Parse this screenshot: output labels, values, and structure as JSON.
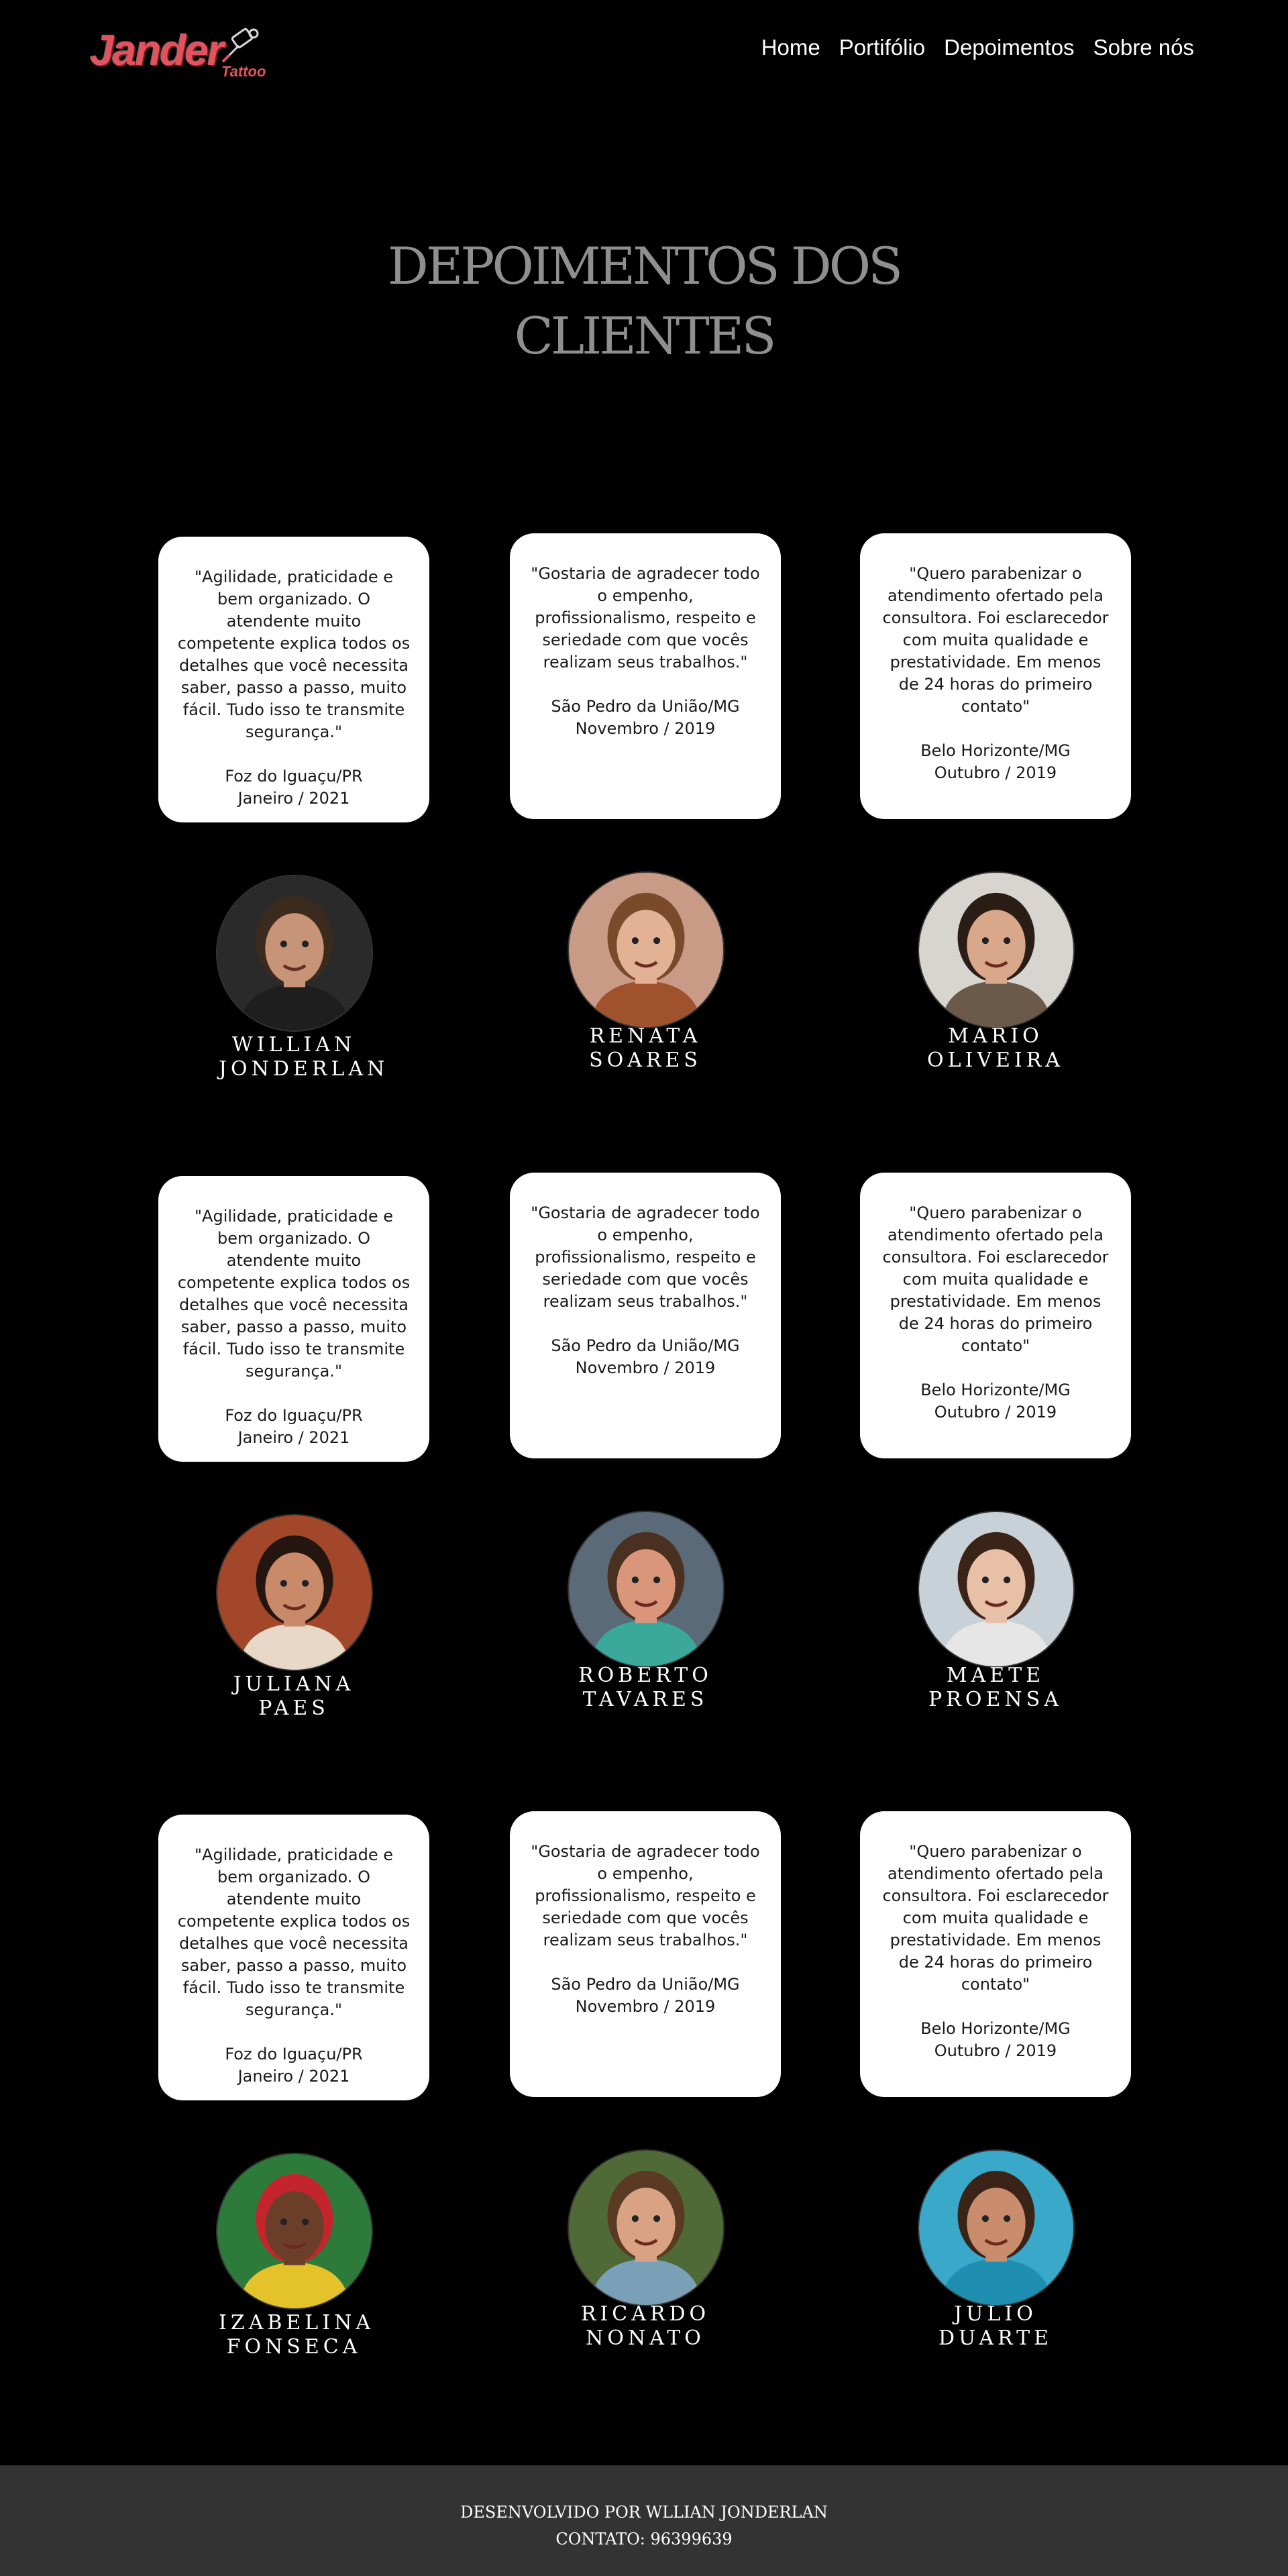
{
  "header": {
    "logo_text": "Jander",
    "logo_sub": "Tattoo",
    "nav": [
      "Home",
      "Portifólio",
      "Depoimentos",
      "Sobre nós"
    ]
  },
  "page_title": "DEPOIMENTOS DOS CLIENTES",
  "testimonials": [
    {
      "quote": "\"Agilidade, praticidade e bem organizado. O atendente muito competente explica todos os detalhes que você necessita saber, passo a passo, muito fácil. Tudo isso te transmite segurança.\"",
      "city": "Foz do Iguaçu/PR",
      "date": "Janeiro / 2021",
      "name": "WILLIAN JONDERLAN",
      "skin": "#c89478",
      "hair": "#3b2a1e",
      "bg": "#2a2a2a",
      "shirt": "#1e1e1e"
    },
    {
      "quote": "\"Gostaria de agradecer todo o empenho, profissionalismo, respeito e seriedade com que vocês realizam seus trabalhos.\"",
      "city": "São Pedro da União/MG",
      "date": "Novembro / 2019",
      "name": "RENATA SOARES",
      "skin": "#e3b194",
      "hair": "#7b4a2a",
      "bg": "#c99b87",
      "shirt": "#a0522d"
    },
    {
      "quote": "\"Quero parabenizar o atendimento ofertado pela consultora. Foi esclarecedor com muita qualidade e prestatividade. Em menos de 24 horas do primeiro contato\"",
      "city": "Belo Horizonte/MG",
      "date": "Outubro / 2019",
      "name": "MARIO OLIVEIRA",
      "skin": "#d9a88a",
      "hair": "#2a1d16",
      "bg": "#d8d4cf",
      "shirt": "#6b5a4a"
    },
    {
      "quote": "\"Agilidade, praticidade e bem organizado. O atendente muito competente explica todos os detalhes que você necessita saber, passo a passo, muito fácil. Tudo isso te transmite segurança.\"",
      "city": "Foz do Iguaçu/PR",
      "date": "Janeiro / 2021",
      "name": "JULIANA PAES",
      "skin": "#c98a6a",
      "hair": "#241510",
      "bg": "#a3472b",
      "shirt": "#e8d8c8"
    },
    {
      "quote": "\"Gostaria de agradecer todo o empenho, profissionalismo, respeito e seriedade com que vocês realizam seus trabalhos.\"",
      "city": "São Pedro da União/MG",
      "date": "Novembro / 2019",
      "name": "ROBERTO TAVARES",
      "skin": "#d9967a",
      "hair": "#4a3020",
      "bg": "#5a6a78",
      "shirt": "#3aa89a"
    },
    {
      "quote": "\"Quero parabenizar o atendimento ofertado pela consultora. Foi esclarecedor com muita qualidade e prestatividade. Em menos de 24 horas do primeiro contato\"",
      "city": "Belo Horizonte/MG",
      "date": "Outubro / 2019",
      "name": "MAETE PROENSA",
      "skin": "#e8c0a8",
      "hair": "#3a2418",
      "bg": "#c8d0d8",
      "shirt": "#e6e6e6"
    },
    {
      "quote": "\"Agilidade, praticidade e bem organizado. O atendente muito competente explica todos os detalhes que você necessita saber, passo a passo, muito fácil. Tudo isso te transmite segurança.\"",
      "city": "Foz do Iguaçu/PR",
      "date": "Janeiro / 2021",
      "name": "IZABELINA FONSECA",
      "skin": "#6b3e2a",
      "hair": "#c4242c",
      "bg": "#2e7a3a",
      "shirt": "#e3c22a"
    },
    {
      "quote": "\"Gostaria de agradecer todo o empenho, profissionalismo, respeito e seriedade com que vocês realizam seus trabalhos.\"",
      "city": "São Pedro da União/MG",
      "date": "Novembro / 2019",
      "name": "RICARDO NONATO",
      "skin": "#d8a283",
      "hair": "#5a3a22",
      "bg": "#4f6a36",
      "shirt": "#7aa0b8"
    },
    {
      "quote": "\"Quero parabenizar o atendimento ofertado pela consultora. Foi esclarecedor com muita qualidade e prestatividade. Em menos de 24 horas do primeiro contato\"",
      "city": "Belo Horizonte/MG",
      "date": "Outubro / 2019",
      "name": "JULIO DUARTE",
      "skin": "#c98c6c",
      "hair": "#3a2418",
      "bg": "#3aa8c8",
      "shirt": "#1e8fb0"
    }
  ],
  "footer": {
    "developed_by": "DESENVOLVIDO POR WLLIAN JONDERLAN",
    "contact": "CONTATO: 96399639"
  }
}
